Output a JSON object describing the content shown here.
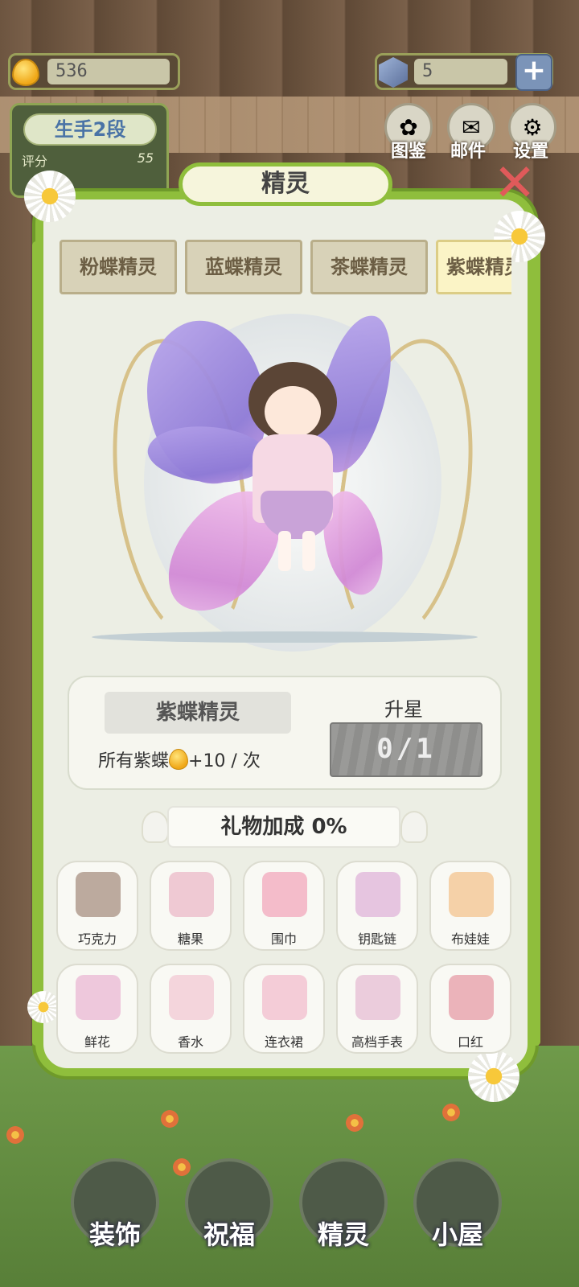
{
  "hud": {
    "drops": "536",
    "gems": "5",
    "rank_title": "生手2段",
    "rank_label": "评分",
    "rank_score": "55",
    "top_icons": [
      {
        "label": "图鉴",
        "icon": "book-icon"
      },
      {
        "label": "邮件",
        "icon": "mail-icon"
      },
      {
        "label": "设置",
        "icon": "gear-icon"
      }
    ]
  },
  "modal": {
    "title": "精灵",
    "tabs": [
      "粉蝶精灵",
      "蓝蝶精灵",
      "茶蝶精灵",
      "紫蝶精灵"
    ],
    "active_tab": 3
  },
  "info": {
    "name": "紫蝶精灵",
    "bonus_prefix": "所有紫蝶",
    "bonus_suffix": "+10 / 次",
    "star_label": "升星",
    "star_progress": "0/1"
  },
  "gift_bonus": "礼物加成 0%",
  "gifts": [
    {
      "name": "巧克力",
      "color": "#8a6a58"
    },
    {
      "name": "糖果",
      "color": "#e8a3b8"
    },
    {
      "name": "围巾",
      "color": "#f08aa8"
    },
    {
      "name": "钥匙链",
      "color": "#d79ad0"
    },
    {
      "name": "布娃娃",
      "color": "#f2b06a"
    },
    {
      "name": "鲜花",
      "color": "#e6a0c8"
    },
    {
      "name": "香水",
      "color": "#f0b8c8"
    },
    {
      "name": "连衣裙",
      "color": "#f0a8c0"
    },
    {
      "name": "高档手表",
      "color": "#e0a8c8"
    },
    {
      "name": "口红",
      "color": "#e07a8a"
    }
  ],
  "bottom_nav": [
    {
      "label": "装饰"
    },
    {
      "label": "祝福"
    },
    {
      "label": "精灵"
    },
    {
      "label": "小屋"
    }
  ]
}
